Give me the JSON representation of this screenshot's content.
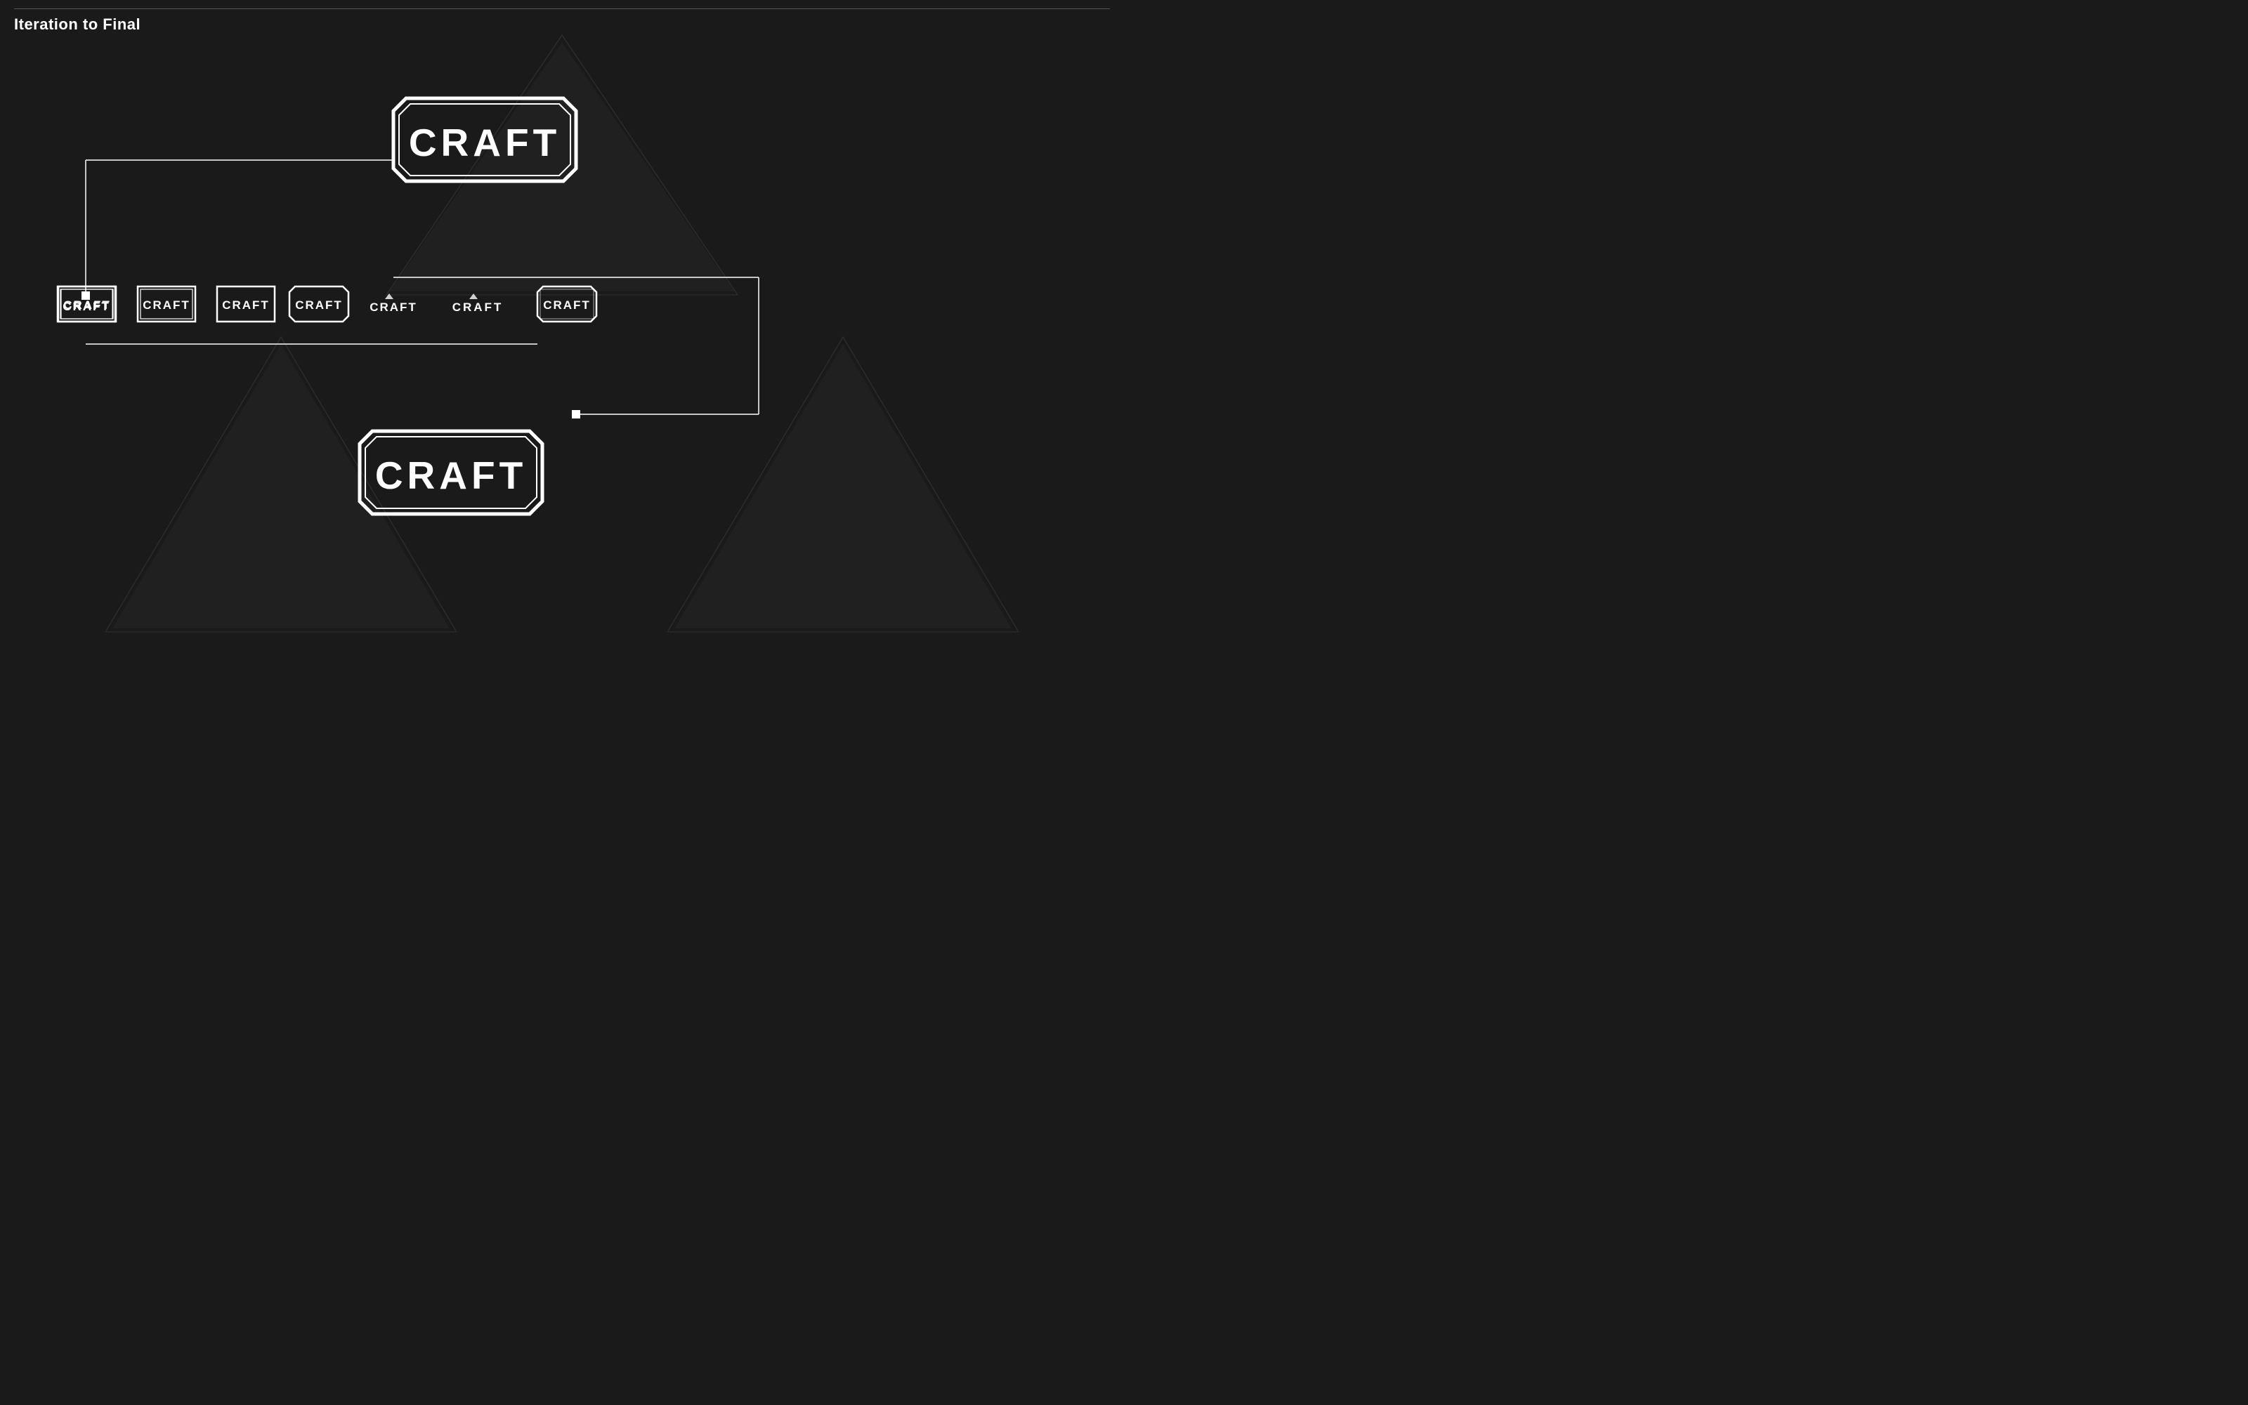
{
  "page": {
    "title": "Iteration to Final",
    "background_color": "#1a1a1a",
    "accent_color": "#ffffff"
  },
  "logos": {
    "large_top_label": "CRAFT",
    "large_bottom_label": "CRAFT",
    "small_logos": [
      {
        "label": "CRAFT",
        "style": "bordered-square"
      },
      {
        "label": "CRAFT",
        "style": "bordered-square"
      },
      {
        "label": "CRAFT",
        "style": "bordered-square"
      },
      {
        "label": "CRAFT",
        "style": "bordered-hex"
      },
      {
        "label": "CRAFT",
        "style": "no-border"
      },
      {
        "label": "CRAFT",
        "style": "no-border"
      },
      {
        "label": "CRAFT",
        "style": "bordered-hex"
      }
    ]
  }
}
